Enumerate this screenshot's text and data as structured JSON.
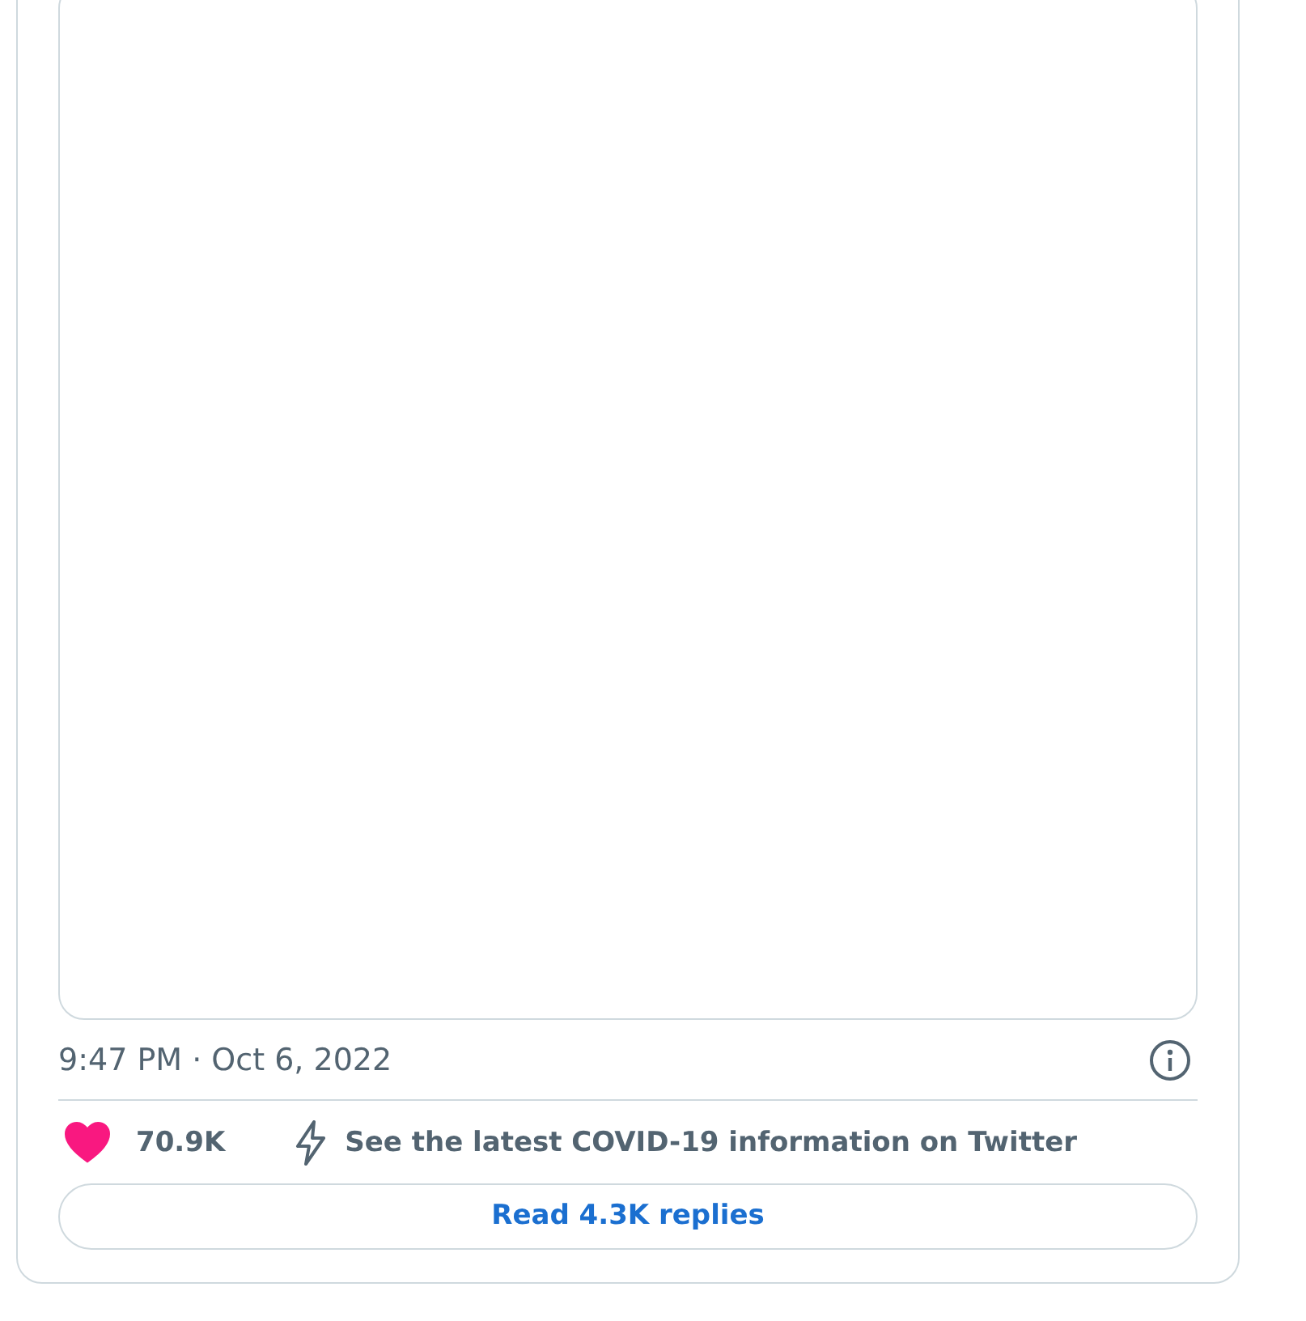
{
  "tweet": {
    "timestamp": "9:47 PM · Oct 6, 2022",
    "likes": {
      "count": "70.9K",
      "liked": true
    },
    "notice": "See the latest COVID-19 information on Twitter",
    "replies_button": "Read 4.3K replies"
  }
}
